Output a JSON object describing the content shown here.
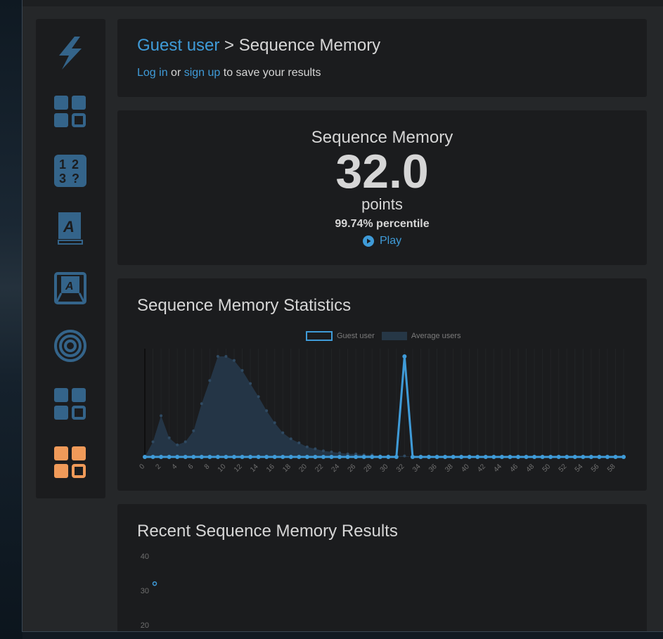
{
  "breadcrumb": {
    "user": "Guest user",
    "separator": " > ",
    "page": "Sequence Memory"
  },
  "save_prompt": {
    "login": "Log in",
    "or": " or ",
    "signup": "sign up",
    "rest": " to save your results"
  },
  "score": {
    "title": "Sequence Memory",
    "value": "32.0",
    "unit": "points",
    "percentile": "99.74% percentile",
    "play_label": "Play"
  },
  "sidebar": {
    "items": [
      {
        "icon": "lightning-icon"
      },
      {
        "icon": "grid-blocks-icon"
      },
      {
        "icon": "number-memory-icon"
      },
      {
        "icon": "verbal-memory-book-icon"
      },
      {
        "icon": "typing-key-icon"
      },
      {
        "icon": "target-icon"
      },
      {
        "icon": "grid-blocks-icon"
      },
      {
        "icon": "grid-blocks-orange-icon"
      }
    ]
  },
  "colors": {
    "accent": "#3f9bd8",
    "active": "#f09a59",
    "icon": "#34648a",
    "card": "#1b1c1e",
    "page": "#252729"
  },
  "stats": {
    "title": "Sequence Memory Statistics"
  },
  "recent": {
    "title": "Recent Sequence Memory Results"
  },
  "chart_data": [
    {
      "type": "line",
      "title": "Sequence Memory Statistics",
      "legend": [
        "Guest user",
        "Average users"
      ],
      "legend_position": "top",
      "x_ticks": [
        0,
        2,
        4,
        6,
        8,
        10,
        12,
        14,
        16,
        18,
        20,
        22,
        24,
        26,
        28,
        30,
        32,
        34,
        36,
        38,
        40,
        42,
        44,
        46,
        48,
        50,
        52,
        54,
        56,
        58
      ],
      "x": [
        0,
        1,
        2,
        3,
        4,
        5,
        6,
        7,
        8,
        9,
        10,
        11,
        12,
        13,
        14,
        15,
        16,
        17,
        18,
        19,
        20,
        21,
        22,
        23,
        24,
        25,
        26,
        27,
        28,
        29,
        30,
        31,
        32,
        33,
        34,
        35,
        36,
        37,
        38,
        39,
        40,
        41,
        42,
        43,
        44,
        45,
        46,
        47,
        48,
        49,
        50,
        51,
        52,
        53,
        54,
        55,
        56,
        57,
        58,
        59
      ],
      "series": [
        {
          "name": "Guest user",
          "values": [
            0,
            0,
            0,
            0,
            0,
            0,
            0,
            0,
            0,
            0,
            0,
            0,
            0,
            0,
            0,
            0,
            0,
            0,
            0,
            0,
            0,
            0,
            0,
            0,
            0,
            0,
            0,
            0,
            0,
            0,
            0,
            0,
            100,
            0,
            0,
            0,
            0,
            0,
            0,
            0,
            0,
            0,
            0,
            0,
            0,
            0,
            0,
            0,
            0,
            0,
            0,
            0,
            0,
            0,
            0,
            0,
            0,
            0,
            0,
            0
          ]
        },
        {
          "name": "Average users",
          "values": [
            0,
            15,
            41,
            19,
            12,
            15,
            26,
            53,
            76,
            100,
            100,
            96,
            86,
            73,
            60,
            46,
            34,
            24,
            18,
            14,
            10,
            8,
            6,
            5,
            4,
            3,
            3,
            2,
            2,
            1,
            1,
            1,
            1,
            0,
            0,
            0,
            0,
            0,
            0,
            0,
            0,
            0,
            0,
            0,
            0,
            0,
            0,
            0,
            0,
            0,
            0,
            0,
            0,
            0,
            0,
            0,
            0,
            0,
            0,
            0
          ]
        }
      ],
      "ylim": [
        0,
        100
      ]
    },
    {
      "type": "scatter",
      "title": "Recent Sequence Memory Results",
      "y_ticks": [
        40,
        30,
        20
      ],
      "points": [
        {
          "x": 1,
          "y": 32
        }
      ]
    }
  ]
}
